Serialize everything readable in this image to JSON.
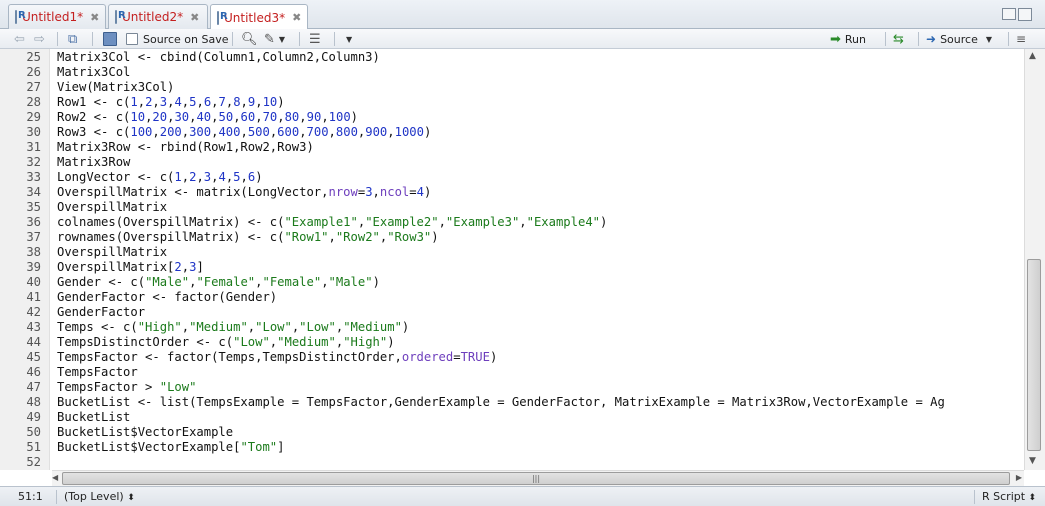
{
  "tabs": [
    {
      "label": "Untitled1*",
      "active": false
    },
    {
      "label": "Untitled2*",
      "active": false
    },
    {
      "label": "Untitled3*",
      "active": true
    }
  ],
  "toolbar": {
    "source_on_save": "Source on Save",
    "run": "Run",
    "source": "Source"
  },
  "editor": {
    "lines": [
      {
        "n": "25",
        "code": "Matrix3Col <- cbind(Column1,Column2,Column3)"
      },
      {
        "n": "26",
        "code": "Matrix3Col"
      },
      {
        "n": "27",
        "code": "View(Matrix3Col)"
      },
      {
        "n": "28",
        "code": "Row1 <- c(1,2,3,4,5,6,7,8,9,10)"
      },
      {
        "n": "29",
        "code": "Row2 <- c(10,20,30,40,50,60,70,80,90,100)"
      },
      {
        "n": "30",
        "code": "Row3 <- c(100,200,300,400,500,600,700,800,900,1000)"
      },
      {
        "n": "31",
        "code": "Matrix3Row <- rbind(Row1,Row2,Row3)"
      },
      {
        "n": "32",
        "code": "Matrix3Row"
      },
      {
        "n": "33",
        "code": "LongVector <- c(1,2,3,4,5,6)"
      },
      {
        "n": "34",
        "code": "OverspillMatrix <- matrix(LongVector,nrow=3,ncol=4)"
      },
      {
        "n": "35",
        "code": "OverspillMatrix"
      },
      {
        "n": "36",
        "code": "colnames(OverspillMatrix) <- c(\"Example1\",\"Example2\",\"Example3\",\"Example4\")"
      },
      {
        "n": "37",
        "code": "rownames(OverspillMatrix) <- c(\"Row1\",\"Row2\",\"Row3\")"
      },
      {
        "n": "38",
        "code": "OverspillMatrix"
      },
      {
        "n": "39",
        "code": "OverspillMatrix[2,3]"
      },
      {
        "n": "40",
        "code": "Gender <- c(\"Male\",\"Female\",\"Female\",\"Male\")"
      },
      {
        "n": "41",
        "code": "GenderFactor <- factor(Gender)"
      },
      {
        "n": "42",
        "code": "GenderFactor"
      },
      {
        "n": "43",
        "code": "Temps <- c(\"High\",\"Medium\",\"Low\",\"Low\",\"Medium\")"
      },
      {
        "n": "44",
        "code": "TempsDistinctOrder <- c(\"Low\",\"Medium\",\"High\")"
      },
      {
        "n": "45",
        "code": "TempsFactor <- factor(Temps,TempsDistinctOrder,ordered=TRUE)"
      },
      {
        "n": "46",
        "code": "TempsFactor"
      },
      {
        "n": "47",
        "code": "TempsFactor > \"Low\""
      },
      {
        "n": "48",
        "code": "BucketList <- list(TempsExample = TempsFactor,GenderExample = GenderFactor, MatrixExample = Matrix3Row,VectorExample = Ag"
      },
      {
        "n": "49",
        "code": "BucketList"
      },
      {
        "n": "50",
        "code": "BucketList$VectorExample"
      },
      {
        "n": "51",
        "code": "BucketList$VectorExample[\"Tom\"]"
      },
      {
        "n": "52",
        "code": ""
      }
    ]
  },
  "status": {
    "position": "51:1",
    "scope": "(Top Level)",
    "filetype": "R Script"
  },
  "colors": {
    "number": "#1f34c6",
    "string": "#1b7a1b",
    "keyword": "#6e3fbd",
    "tab_label": "#c41f1f"
  }
}
